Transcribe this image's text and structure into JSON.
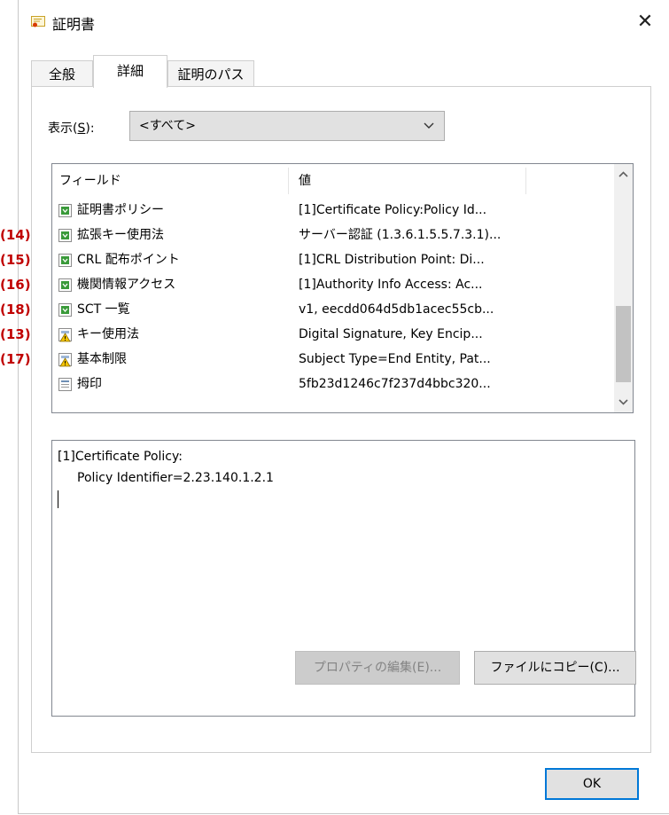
{
  "window": {
    "title": "証明書",
    "close_glyph": "✕"
  },
  "tabs": [
    {
      "label": "全般"
    },
    {
      "label": "詳細"
    },
    {
      "label": "証明のパス"
    }
  ],
  "show": {
    "label_prefix": "表示(",
    "label_key": "S",
    "label_suffix": "):",
    "selected": "<すべて>"
  },
  "list": {
    "columns": {
      "field": "フィールド",
      "value": "値"
    },
    "rows": [
      {
        "icon": "cert-ext-icon",
        "field": "証明書ポリシー",
        "value": "[1]Certificate Policy:Policy Id..."
      },
      {
        "icon": "cert-ext-icon",
        "field": "拡張キー使用法",
        "value": "サーバー認証 (1.3.6.1.5.5.7.3.1)..."
      },
      {
        "icon": "cert-ext-icon",
        "field": "CRL 配布ポイント",
        "value": "[1]CRL Distribution Point: Di..."
      },
      {
        "icon": "cert-ext-icon",
        "field": "機関情報アクセス",
        "value": "[1]Authority Info Access: Ac..."
      },
      {
        "icon": "cert-ext-icon",
        "field": "SCT 一覧",
        "value": "v1, eecdd064d5db1acec55cb..."
      },
      {
        "icon": "cert-warning-icon",
        "field": "キー使用法",
        "value": "Digital Signature, Key Encip..."
      },
      {
        "icon": "cert-warning-icon",
        "field": "基本制限",
        "value": "Subject Type=End Entity, Pat..."
      },
      {
        "icon": "cert-property-icon",
        "field": "拇印",
        "value": "5fb23d1246c7f237d4bbc320..."
      }
    ]
  },
  "detail": {
    "line1": "[1]Certificate Policy:",
    "line2": "Policy Identifier=2.23.140.1.2.1"
  },
  "buttons": {
    "edit_properties": "プロパティの編集(E)...",
    "copy_to_file": "ファイルにコピー(C)...",
    "ok": "OK"
  },
  "annotations": [
    {
      "label": "(14)",
      "row": 1
    },
    {
      "label": "(15)",
      "row": 2
    },
    {
      "label": "(16)",
      "row": 3
    },
    {
      "label": "(18)",
      "row": 4
    },
    {
      "label": "(13)",
      "row": 5
    },
    {
      "label": "(17)",
      "row": 6
    }
  ],
  "colors": {
    "annotation": "#c00000",
    "focus_border": "#0078d7"
  }
}
